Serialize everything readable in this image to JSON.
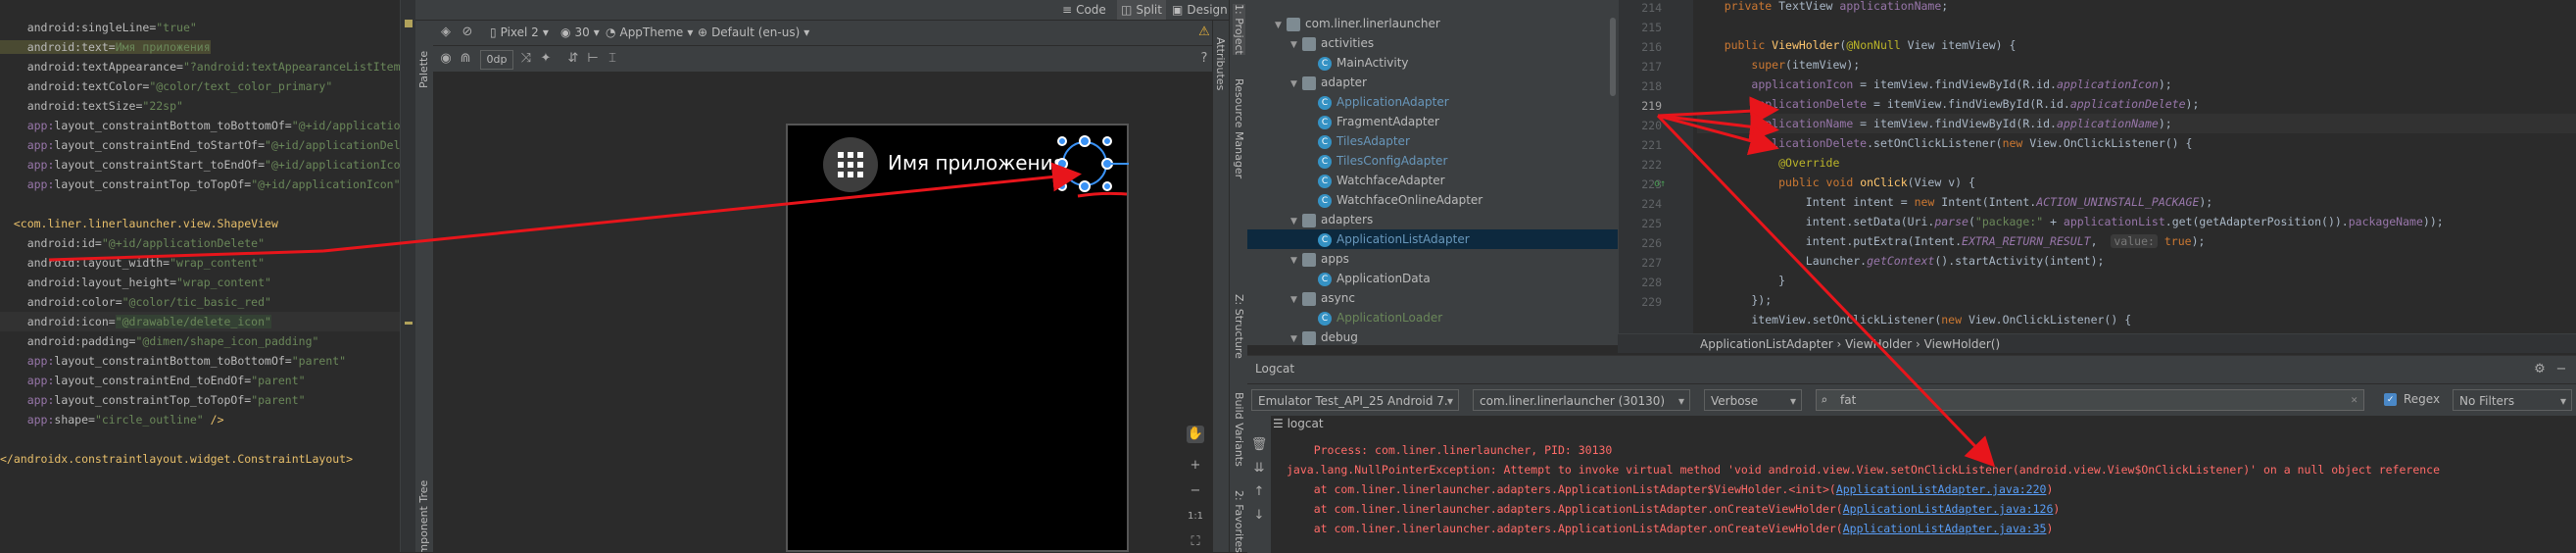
{
  "xml_editor": {
    "lines": [
      "    android:singleLine=\"true\"",
      "    android:text=\"Имя приложения\"",
      "    android:textAppearance=\"?android:textAppearanceListItem\"",
      "    android:textColor=\"@color/text_color_primary\"",
      "    android:textSize=\"22sp\"",
      "    app:layout_constraintBottom_toBottomOf=\"@+id/applicationIcon\"",
      "    app:layout_constraintEnd_toStartOf=\"@+id/applicationDelete\"",
      "    app:layout_constraintStart_toEndOf=\"@+id/applicationIcon\"",
      "    app:layout_constraintTop_toTopOf=\"@+id/applicationIcon\" />",
      "",
      "<com.liner.linerlauncher.view.ShapeView",
      "    android:id=\"@+id/applicationDelete\"",
      "    android:layout_width=\"wrap_content\"",
      "    android:layout_height=\"wrap_content\"",
      "    android:color=\"@color/tic_basic_red\"",
      "    android:icon=\"@drawable/delete_icon\"",
      "    android:padding=\"@dimen/shape_icon_padding\"",
      "    app:layout_constraintBottom_toBottomOf=\"parent\"",
      "    app:layout_constraintEnd_toEndOf=\"parent\"",
      "    app:layout_constraintTop_toTopOf=\"parent\"",
      "    app:shape=\"circle_outline\" />",
      "",
      "</androidx.constraintlayout.widget.ConstraintLayout>"
    ]
  },
  "design_toolbar": {
    "device": "Pixel 2",
    "api": "30",
    "theme": "AppTheme",
    "locale": "Default (en-us)",
    "dp_value": "0dp",
    "modes": [
      "Code",
      "Split",
      "Design"
    ]
  },
  "palette": {
    "label": "Palette",
    "component_tree": "Component Tree",
    "attributes": "Attributes"
  },
  "preview": {
    "app_name": "Имя приложения"
  },
  "zoom": {
    "ratio": "1:1"
  },
  "side_tabs": {
    "project": "1: Project",
    "resource_manager": "Resource Manager",
    "structure": "Z: Structure",
    "build_variants": "Build Variants",
    "favorites": "2: Favorites"
  },
  "project_tree": {
    "rows": [
      {
        "label": "com.liner.linerlauncher",
        "kind": "pkg",
        "depth": 0
      },
      {
        "label": "activities",
        "kind": "pkg",
        "depth": 1
      },
      {
        "label": "MainActivity",
        "kind": "class",
        "depth": 2
      },
      {
        "label": "adapter",
        "kind": "pkg",
        "depth": 1
      },
      {
        "label": "ApplicationAdapter",
        "kind": "class",
        "depth": 2,
        "color": "#6897bb"
      },
      {
        "label": "FragmentAdapter",
        "kind": "class",
        "depth": 2
      },
      {
        "label": "TilesAdapter",
        "kind": "class",
        "depth": 2,
        "color": "#6897bb"
      },
      {
        "label": "TilesConfigAdapter",
        "kind": "class",
        "depth": 2,
        "color": "#6897bb"
      },
      {
        "label": "WatchfaceAdapter",
        "kind": "class",
        "depth": 2
      },
      {
        "label": "WatchfaceOnlineAdapter",
        "kind": "class",
        "depth": 2
      },
      {
        "label": "adapters",
        "kind": "pkg",
        "depth": 1
      },
      {
        "label": "ApplicationListAdapter",
        "kind": "class",
        "depth": 2,
        "selected": true,
        "color": "#6897bb"
      },
      {
        "label": "apps",
        "kind": "pkg",
        "depth": 1
      },
      {
        "label": "ApplicationData",
        "kind": "class",
        "depth": 2
      },
      {
        "label": "async",
        "kind": "pkg",
        "depth": 1
      },
      {
        "label": "ApplicationLoader",
        "kind": "class",
        "depth": 2,
        "color": "#6a8759"
      },
      {
        "label": "debug",
        "kind": "pkg",
        "depth": 1
      }
    ]
  },
  "java_editor": {
    "line_numbers": [
      "214",
      "215",
      "216",
      "217",
      "218",
      "219",
      "220",
      "221",
      "222",
      "223",
      "224",
      "225",
      "226",
      "227",
      "228",
      "229"
    ],
    "breadcrumb": [
      "ApplicationListAdapter",
      "ViewHolder",
      "ViewHolder()"
    ]
  },
  "logcat": {
    "title": "Logcat",
    "device": "Emulator Test_API_25 Android 7.",
    "process": "com.liner.linerlauncher (30130)",
    "level": "Verbose",
    "search": "fat",
    "regex_label": "Regex",
    "filter": "No Filters",
    "tab": "logcat",
    "lines": [
      "Process: com.liner.linerlauncher, PID: 30130",
      "java.lang.NullPointerException: Attempt to invoke virtual method 'void android.view.View.setOnClickListener(android.view.View$OnClickListener)' on a null object reference",
      "    at com.liner.linerlauncher.adapters.ApplicationListAdapter$ViewHolder.<init>(",
      "    at com.liner.linerlauncher.adapters.ApplicationListAdapter.onCreateViewHolder(",
      "    at com.liner.linerlauncher.adapters.ApplicationListAdapter.onCreateViewHolder("
    ],
    "links": [
      "ApplicationListAdapter.java:220",
      "ApplicationListAdapter.java:126",
      "ApplicationListAdapter.java:35"
    ]
  },
  "colors": {
    "arrow": "#e8151b",
    "preview_bg": "#000000",
    "ide_bg": "#2b2b2b"
  }
}
